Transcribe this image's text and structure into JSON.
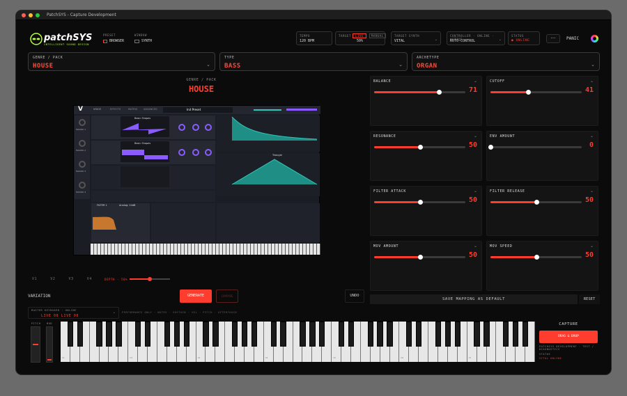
{
  "window": {
    "title": "PatchSYS - Capture Development"
  },
  "brand": {
    "logo": "patchSYS",
    "tagline": "INTELLIGENT SOUND DESIGN"
  },
  "header": {
    "preset_label": "PRESET",
    "preset_value": "BROWSER",
    "window_label": "WINDOW",
    "window_value": "SYNTH",
    "tempo_label": "TEMPO",
    "tempo_value": "120 BPM",
    "target_label": "TARGET",
    "target_value": "50%",
    "target_opt1": "LIVE",
    "target_opt2": "MANUAL",
    "synth_label": "TARGET SYNTH",
    "synth_value": "VITAL",
    "controller_label": "CONTROLLER · ONLINE · ACTIVE",
    "controller_value": "ROTO-CONTROL",
    "status_label": "STATUS",
    "status_value": "● ONLINE",
    "more": "···",
    "panic": "PANIC"
  },
  "selects": [
    {
      "label": "GENRE / PACK",
      "value": "HOUSE"
    },
    {
      "label": "TYPE",
      "value": "BASS"
    },
    {
      "label": "ARCHETYPE",
      "value": "ORGAN"
    }
  ],
  "main": {
    "subtitle": "GENRE / PACK",
    "title": "HOUSE"
  },
  "vital": {
    "tabs": [
      "VOICE",
      "EFFECTS",
      "MATRIX",
      "ADVANCED"
    ],
    "preset": "Init Preset",
    "osc1": "Basic Shapes",
    "osc2": "Basic Shapes",
    "filter": "FILTER 1",
    "filter_type": "Analog: 24dB",
    "lfo_shape": "Triangle",
    "macros": [
      "MACRO 1",
      "MACRO 2",
      "MACRO 3",
      "MACRO 4"
    ]
  },
  "variations": [
    "V1",
    "V2",
    "V3",
    "V4"
  ],
  "depth": {
    "label": "DEPTH · 50%",
    "value": 0.5
  },
  "actions": {
    "variation": "VARIATION",
    "generate": "GENERATE",
    "compare": "COMPARE",
    "undo": "UNDO"
  },
  "params": [
    {
      "name": "BALANCE",
      "value": 71
    },
    {
      "name": "CUTOFF",
      "value": 41
    },
    {
      "name": "RESONANCE",
      "value": 50
    },
    {
      "name": "ENV AMOUNT",
      "value": 0
    },
    {
      "name": "FILTER ATTACK",
      "value": 50
    },
    {
      "name": "FILTER RELEASE",
      "value": 50
    },
    {
      "name": "MOV AMOUNT",
      "value": 50
    },
    {
      "name": "MOV SPEED",
      "value": 50
    }
  ],
  "mapping": {
    "save": "SAVE MAPPING AS DEFAULT",
    "reset": "RESET"
  },
  "keyboard": {
    "master_label": "MASTER KEYBOARD · ONLINE",
    "master_value": "LIVE 08 LIVE 08",
    "hint": "PERFORMANCE ONLY · NOTES · SUSTAIN · VEL · PITCH · AFTERTOUCH",
    "pitch": "PITCH",
    "mod": "MOD",
    "octaves": [
      "C1",
      "C2",
      "C3",
      "C4",
      "C5",
      "C6",
      "C7"
    ]
  },
  "capture": {
    "title": "CAPTURE",
    "button": "DRAG & DROP",
    "line1": "PATCHSYS DEVELOPMENT · TEST / DIAGNOSTICS",
    "status_label": "STATUS",
    "status_value": "VITAL ONLINE"
  },
  "colors": {
    "accent": "#ff3d2e",
    "vital_purple": "#8a5cff",
    "vital_teal": "#2fc8b8"
  }
}
